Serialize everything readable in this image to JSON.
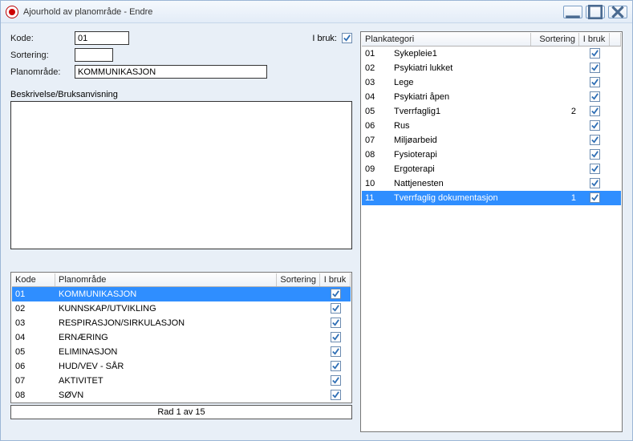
{
  "window": {
    "title": "Ajourhold av planområde - Endre"
  },
  "form": {
    "kode_label": "Kode:",
    "kode_value": "01",
    "sortering_label": "Sortering:",
    "sortering_value": "",
    "planomrade_label": "Planområde:",
    "planomrade_value": "KOMMUNIKASJON",
    "ibruk_label": "I bruk:",
    "ibruk_checked": true,
    "beskrivelse_label": "Beskrivelse/Bruksanvisning"
  },
  "left_grid": {
    "headers": {
      "kode": "Kode",
      "plan": "Planområde",
      "sort": "Sortering",
      "ibruk": "I bruk"
    },
    "rows": [
      {
        "kode": "01",
        "plan": "KOMMUNIKASJON",
        "sort": "",
        "ibruk": true,
        "selected": true
      },
      {
        "kode": "02",
        "plan": "KUNNSKAP/UTVIKLING",
        "sort": "",
        "ibruk": true
      },
      {
        "kode": "03",
        "plan": "RESPIRASJON/SIRKULASJON",
        "sort": "",
        "ibruk": true
      },
      {
        "kode": "04",
        "plan": "ERNÆRING",
        "sort": "",
        "ibruk": true
      },
      {
        "kode": "05",
        "plan": "ELIMINASJON",
        "sort": "",
        "ibruk": true
      },
      {
        "kode": "06",
        "plan": "HUD/VEV  - SÅR",
        "sort": "",
        "ibruk": true
      },
      {
        "kode": "07",
        "plan": "AKTIVITET",
        "sort": "",
        "ibruk": true
      },
      {
        "kode": "08",
        "plan": "SØVN",
        "sort": "",
        "ibruk": true
      }
    ],
    "status": "Rad 1 av 15"
  },
  "right_grid": {
    "headers": {
      "kat": "Plankategori",
      "sort": "Sortering",
      "ibruk": "I bruk"
    },
    "rows": [
      {
        "code": "01",
        "name": "Sykepleie1",
        "sort": "",
        "ibruk": true
      },
      {
        "code": "02",
        "name": "Psykiatri lukket",
        "sort": "",
        "ibruk": true
      },
      {
        "code": "03",
        "name": "Lege",
        "sort": "",
        "ibruk": true
      },
      {
        "code": "04",
        "name": "Psykiatri åpen",
        "sort": "",
        "ibruk": true
      },
      {
        "code": "05",
        "name": "Tverrfaglig1",
        "sort": "2",
        "ibruk": true
      },
      {
        "code": "06",
        "name": "Rus",
        "sort": "",
        "ibruk": true
      },
      {
        "code": "07",
        "name": "Miljøarbeid",
        "sort": "",
        "ibruk": true
      },
      {
        "code": "08",
        "name": "Fysioterapi",
        "sort": "",
        "ibruk": true
      },
      {
        "code": "09",
        "name": "Ergoterapi",
        "sort": "",
        "ibruk": true
      },
      {
        "code": "10",
        "name": "Nattjenesten",
        "sort": "",
        "ibruk": true
      },
      {
        "code": "11",
        "name": "Tverrfaglig dokumentasjon",
        "sort": "1",
        "ibruk": true,
        "selected": true
      }
    ]
  }
}
